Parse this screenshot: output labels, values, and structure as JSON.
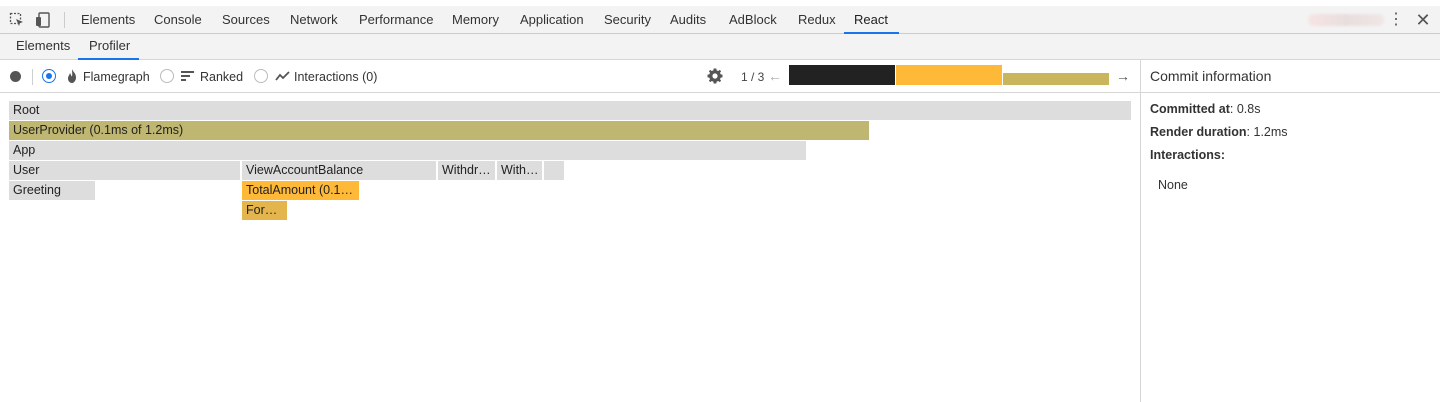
{
  "devtools_tabs": [
    "Elements",
    "Console",
    "Sources",
    "Network",
    "Performance",
    "Memory",
    "Application",
    "Security",
    "Audits",
    "AdBlock",
    "Redux",
    "React"
  ],
  "active_devtools_tab": "React",
  "react_tabs": [
    "Elements",
    "Profiler"
  ],
  "active_react_tab": "Profiler",
  "toolbar": {
    "options": [
      {
        "label": "Flamegraph",
        "icon": "flame-icon",
        "checked": true
      },
      {
        "label": "Ranked",
        "icon": "ranked-icon",
        "checked": false
      },
      {
        "label": "Interactions (0)",
        "icon": "interactions-icon",
        "checked": false
      }
    ],
    "commit_position": "1 / 3",
    "commits": [
      {
        "color": "#222222",
        "relative_duration": 1.0
      },
      {
        "color": "#ffb938",
        "relative_duration": 1.0
      },
      {
        "color": "#c9b65c",
        "relative_duration": 0.6
      }
    ]
  },
  "flamegraph": {
    "nodes": [
      {
        "label": "Root",
        "color": "#dddddd"
      },
      {
        "label": "UserProvider (0.1ms of 1.2ms)",
        "color": "#bfb771"
      },
      {
        "label": "App",
        "color": "#dddddd"
      },
      {
        "label": "User",
        "color": "#dddddd"
      },
      {
        "label": "ViewAccountBalance",
        "color": "#dddddd"
      },
      {
        "label": "Withdr…",
        "color": "#dddddd"
      },
      {
        "label": "With…",
        "color": "#dddddd"
      },
      {
        "label": "",
        "color": "#dddddd"
      },
      {
        "label": "Greeting",
        "color": "#dddddd"
      },
      {
        "label": "TotalAmount (0.1…",
        "color": "#ffb938"
      },
      {
        "label": "For…",
        "color": "#e3b54c"
      }
    ]
  },
  "commit_info": {
    "title": "Commit information",
    "committed_at_label": "Committed at",
    "committed_at_value": ": 0.8s",
    "render_duration_label": "Render duration",
    "render_duration_value": ": 1.2ms",
    "interactions_label": "Interactions",
    "interactions_suffix": ":",
    "interactions_value": "None"
  }
}
